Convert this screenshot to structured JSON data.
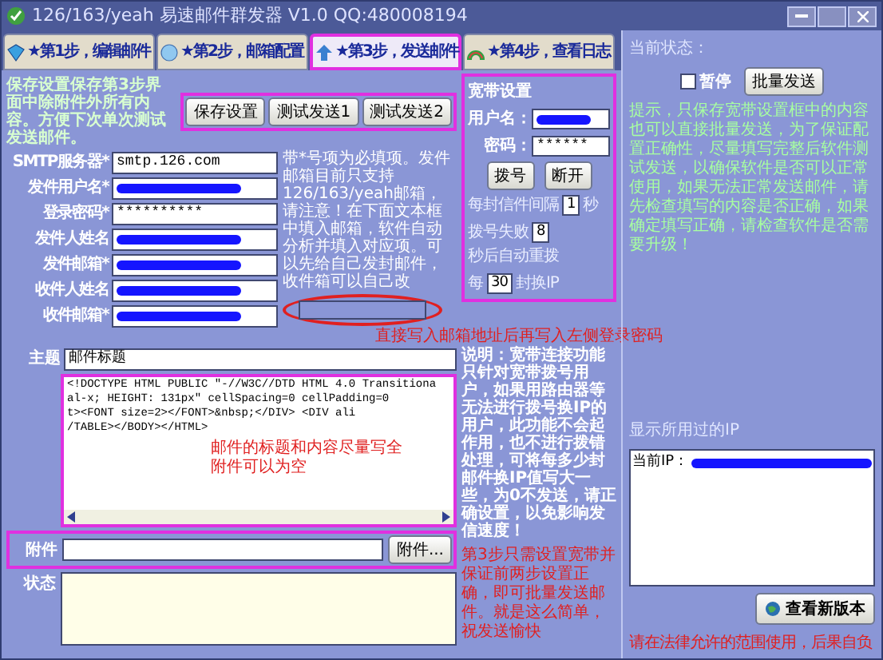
{
  "window": {
    "title": "126/163/yeah 易速邮件群发器 V1.0 QQ:480008194"
  },
  "tabs": [
    {
      "label": "★第1步，编辑邮件",
      "selected": false
    },
    {
      "label": "★第2步，邮箱配置",
      "selected": false
    },
    {
      "label": "★第3步，发送邮件",
      "selected": true
    },
    {
      "label": "★第4步，查看日志",
      "selected": false
    }
  ],
  "save_hint": "保存设置保存第3步界面中除附件外所有内容。方便下次单次测试发送邮件。",
  "toolbar_buttons": [
    "保存设置",
    "测试发送1",
    "测试发送2"
  ],
  "fields": [
    {
      "label": "SMTP服务器*",
      "value": "smtp.126.com",
      "redacted": false
    },
    {
      "label": "发件用户名*",
      "redacted": true
    },
    {
      "label": "登录密码*",
      "value": "**********",
      "redacted": false
    },
    {
      "label": "发件人姓名",
      "redacted": true
    },
    {
      "label": "发件邮箱*",
      "redacted": true
    },
    {
      "label": "收件人姓名",
      "redacted": true
    },
    {
      "label": "收件邮箱*",
      "redacted": true
    }
  ],
  "field_note": "带*号项为必填项。发件邮箱目前只支持126/163/yeah邮箱，请注意！在下面文本框中填入邮箱，软件自动分析并填入对应项。可以先给自己发封邮件，收件箱可以自己改",
  "arrow_note": "直接写入邮箱地址后再写入左侧登录密码",
  "subject": {
    "label": "主题",
    "value": "邮件标题"
  },
  "content_lines": [
    "<!DOCTYPE HTML PUBLIC \"-//W3C//DTD HTML 4.0 Transitiona",
    "al-x; HEIGHT: 131px\" cellSpacing=0 cellPadding=0",
    "t><FONT size=2></FONT>&nbsp;</DIV> <DIV ali",
    "/TABLE></BODY></HTML>"
  ],
  "content_note": [
    "邮件的标题和内容尽量写全",
    "附件可以为空"
  ],
  "attachment": {
    "label": "附件",
    "button": "附件..."
  },
  "status": {
    "label": "状态"
  },
  "broadband": {
    "title": "宽带设置",
    "username_label": "用户名：",
    "password_label": "密码：",
    "password": "******",
    "buttons": [
      "拨号",
      "断开"
    ],
    "settings": [
      {
        "before": "每封信件间隔",
        "value": "1",
        "after": "秒"
      },
      {
        "before": "拨号失败",
        "value": "8",
        "after": "秒后自动重拨"
      },
      {
        "before": "每",
        "value": "30",
        "after": "封换IP"
      }
    ],
    "note": "说明：宽带连接功能只针对宽带拨号用户，如果用路由器等无法进行拨号换IP的用户，此功能不会起作用，也不进行拨错处理，可将每多少封邮件换IP值写大一些，为0不发送，请正确设置，以免影响发信速度！",
    "step_note": "第3步只需设置宽带并保证前两步设置正确，即可批量发送邮件。就是这么简单，祝发送愉快"
  },
  "right_panel": {
    "status_label": "当前状态：",
    "pause": {
      "label": "暂停",
      "checked": false
    },
    "send_button": "批量发送",
    "hint": "提示，只保存宽带设置框中的内容也可以直接批量发送，为了保证配置正确性，尽量填写完整后软件测试发送，以确保软件是否可以正常使用，如果无法正常发送邮件，请先检查填写的内容是否正确，如果确定填写正确，请检查软件是否需要升级！",
    "ip_label": "显示所用过的IP",
    "ip_list": [
      {
        "label": "当前IP：",
        "redacted": true
      }
    ],
    "update_button": "查看新版本",
    "footer": "请在法律允许的范围使用，后果自负"
  }
}
